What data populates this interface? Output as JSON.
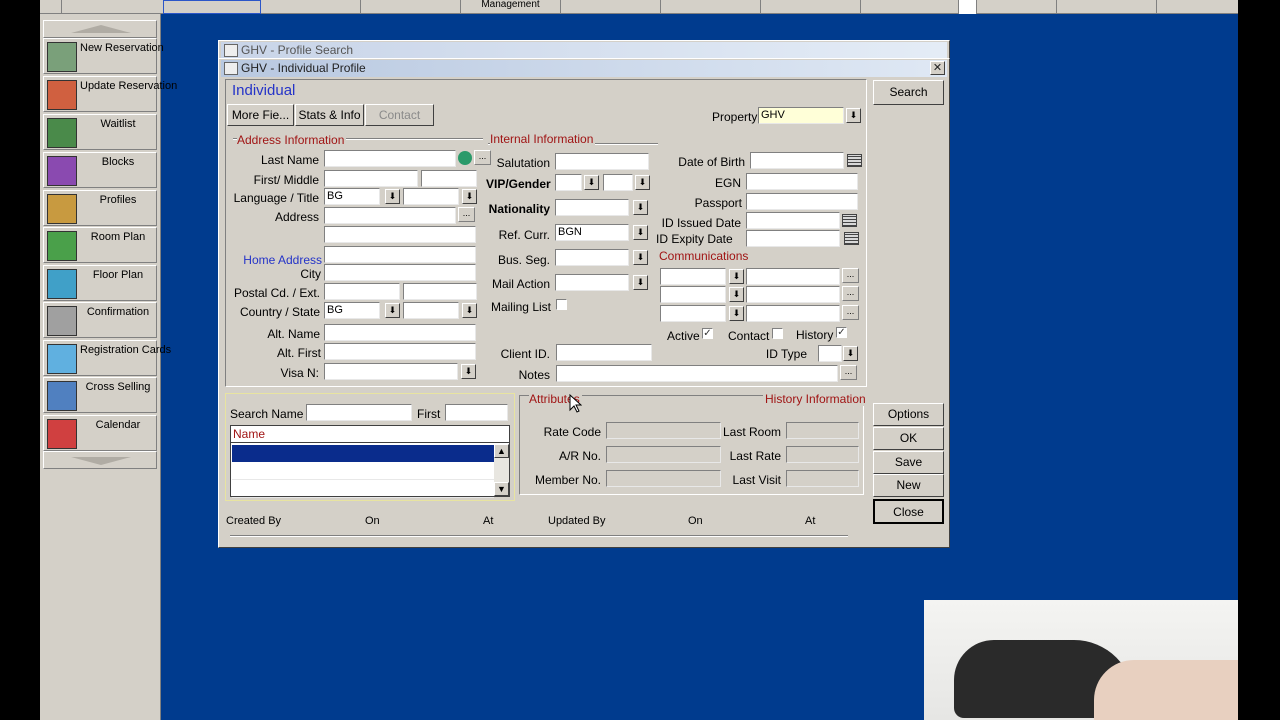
{
  "top_bar": {
    "management_label": "Management"
  },
  "sidebar": {
    "items": [
      {
        "label": "New Reservation",
        "icon": "new-reservation-icon"
      },
      {
        "label": "Update Reservation",
        "icon": "update-reservation-icon"
      },
      {
        "label": "Waitlist",
        "icon": "waitlist-icon"
      },
      {
        "label": "Blocks",
        "icon": "blocks-icon"
      },
      {
        "label": "Profiles",
        "icon": "profiles-icon"
      },
      {
        "label": "Room Plan",
        "icon": "room-plan-icon"
      },
      {
        "label": "Floor Plan",
        "icon": "floor-plan-icon"
      },
      {
        "label": "Confirmation",
        "icon": "confirmation-icon"
      },
      {
        "label": "Registration Cards",
        "icon": "registration-cards-icon"
      },
      {
        "label": "Cross Selling",
        "icon": "cross-selling-icon"
      },
      {
        "label": "Calendar",
        "icon": "calendar-icon"
      }
    ]
  },
  "behind_window": {
    "title": "GHV - Profile Search"
  },
  "window": {
    "title": "GHV - Individual Profile",
    "heading": "Individual",
    "toolbar": {
      "more_fields": "More Fie...",
      "stats_info": "Stats & Info",
      "contact": "Contact"
    },
    "property": {
      "label": "Property",
      "value": "GHV"
    },
    "address": {
      "section": "Address Information",
      "last_name": "Last Name",
      "first_middle": "First/ Middle",
      "language_title": "Language / Title",
      "language_value": "BG",
      "address": "Address",
      "home_address": "Home Address",
      "city": "City",
      "postal_ext": "Postal Cd. / Ext.",
      "country_state": "Country / State",
      "country_value": "BG",
      "alt_name": "Alt. Name",
      "alt_first": "Alt. First",
      "visa": "Visa N:"
    },
    "internal": {
      "section": "Internal Information",
      "salutation": "Salutation",
      "vip_gender": "VIP/Gender",
      "nationality": "Nationality",
      "ref_curr": "Ref. Curr.",
      "ref_curr_value": "BGN",
      "bus_seg": "Bus. Seg.",
      "mail_action": "Mail Action",
      "mailing_list": "Mailing List",
      "client_id": "Client ID.",
      "notes": "Notes"
    },
    "personal": {
      "dob": "Date of Birth",
      "egn": "EGN",
      "passport": "Passport",
      "id_issued": "ID Issued Date",
      "id_expiry": "ID Expity Date",
      "communications": "Communications",
      "active": "Active",
      "contact": "Contact",
      "history": "History",
      "id_type": "ID Type"
    },
    "search": {
      "search_name": "Search Name",
      "first": "First",
      "col_name": "Name"
    },
    "attributes": {
      "section": "Attributes",
      "history_info": "History Information",
      "rate_code": "Rate Code",
      "ar_no": "A/R No.",
      "member_no": "Member No.",
      "last_room": "Last Room",
      "last_rate": "Last Rate",
      "last_visit": "Last Visit"
    },
    "footer": {
      "created_by": "Created By",
      "on1": "On",
      "at1": "At",
      "updated_by": "Updated By",
      "on2": "On",
      "at2": "At"
    },
    "buttons": {
      "search": "Search",
      "options": "Options",
      "ok": "OK",
      "save": "Save",
      "new": "New",
      "close": "Close"
    }
  }
}
